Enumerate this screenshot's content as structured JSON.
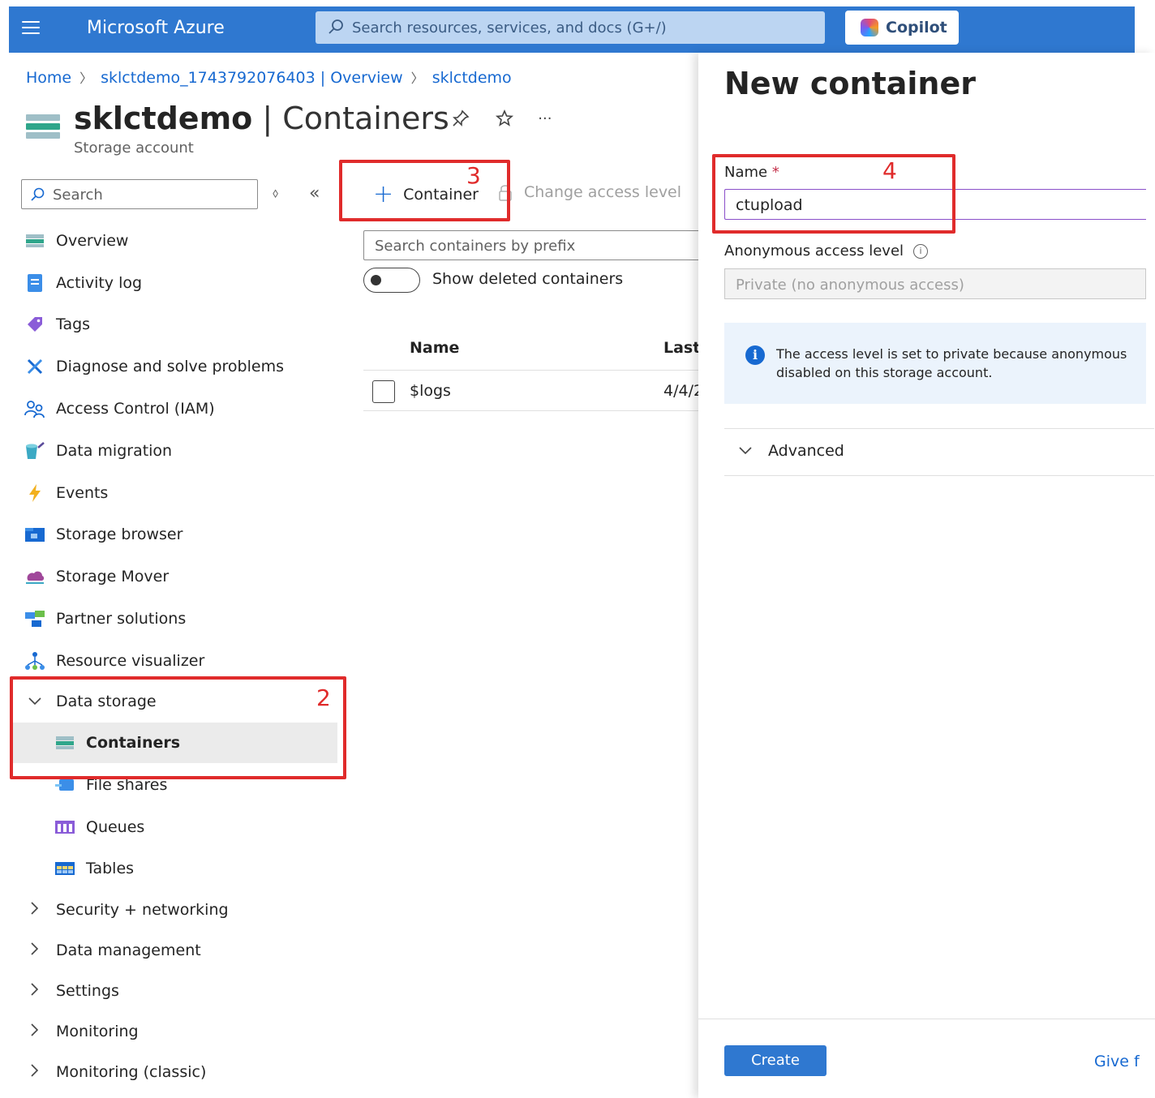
{
  "topbar": {
    "brand": "Microsoft Azure",
    "search_placeholder": "Search resources, services, and docs (G+/)",
    "copilot_label": "Copilot"
  },
  "breadcrumb": {
    "items": [
      "Home",
      "sklctdemo_1743792076403 | Overview",
      "sklctdemo"
    ]
  },
  "header": {
    "resource_name": "sklctdemo",
    "page_name": "| Containers",
    "subtitle": "Storage account",
    "more": "···"
  },
  "nav": {
    "search_placeholder": "Search",
    "items": [
      {
        "label": "Overview",
        "icon": "overview-icon"
      },
      {
        "label": "Activity log",
        "icon": "activity-log-icon"
      },
      {
        "label": "Tags",
        "icon": "tag-icon"
      },
      {
        "label": "Diagnose and solve problems",
        "icon": "wrench-icon"
      },
      {
        "label": "Access Control (IAM)",
        "icon": "people-icon"
      },
      {
        "label": "Data migration",
        "icon": "data-migration-icon"
      },
      {
        "label": "Events",
        "icon": "lightning-icon"
      },
      {
        "label": "Storage browser",
        "icon": "storage-browser-icon"
      },
      {
        "label": "Storage Mover",
        "icon": "storage-mover-icon"
      },
      {
        "label": "Partner solutions",
        "icon": "partner-icon"
      },
      {
        "label": "Resource visualizer",
        "icon": "visualizer-icon"
      }
    ],
    "data_storage": {
      "label": "Data storage",
      "children": [
        {
          "label": "Containers",
          "icon": "containers-icon",
          "selected": true
        },
        {
          "label": "File shares",
          "icon": "file-shares-icon"
        },
        {
          "label": "Queues",
          "icon": "queues-icon"
        },
        {
          "label": "Tables",
          "icon": "tables-icon"
        }
      ]
    },
    "groups": [
      "Security + networking",
      "Data management",
      "Settings",
      "Monitoring",
      "Monitoring (classic)"
    ]
  },
  "toolbar": {
    "add_container_label": "Container",
    "change_access_label": "Change access level"
  },
  "containers": {
    "search_placeholder": "Search containers by prefix",
    "show_deleted_label": "Show deleted containers",
    "show_deleted_on": false,
    "columns": [
      "Name",
      "Last"
    ],
    "rows": [
      {
        "name": "$logs",
        "last": "4/4/2"
      }
    ]
  },
  "panel": {
    "title": "New container",
    "name_label": "Name",
    "name_required": "*",
    "name_value": "ctupload",
    "anon_label": "Anonymous access level",
    "anon_value": "Private (no anonymous access)",
    "info_line1": "The access level is set to private because anonymous",
    "info_line2": "disabled on this storage account.",
    "advanced_label": "Advanced",
    "create_label": "Create",
    "feedback_label": "Give f"
  },
  "annotations": {
    "step2": "2",
    "step3": "3",
    "step4": "4",
    "color": "#e02b2b"
  },
  "colors": {
    "azure_blue": "#2f78d0",
    "link": "#1769d1"
  }
}
